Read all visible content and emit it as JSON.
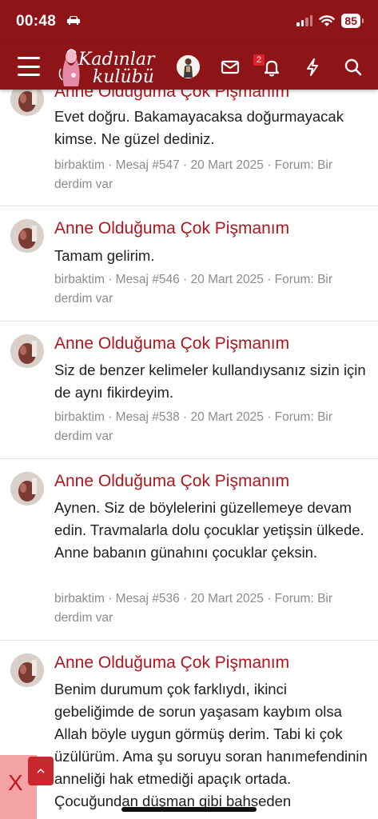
{
  "status_bar": {
    "time": "00:48",
    "battery": "85"
  },
  "header": {
    "logo_line1": "Kadınlar",
    "logo_line2": "kulübü",
    "notification_count": "2"
  },
  "posts": [
    {
      "title": "Anne Olduğuma Çok Pişmanım",
      "body": "Evet doğru. Bakamayacaksa doğurmayacak kimse. Ne güzel dediniz.",
      "meta_line1": "birbaktim · Mesaj #547 · 20 Mart 2025 · Forum: Bir",
      "meta_line2": "derdim var"
    },
    {
      "title": "Anne Olduğuma Çok Pişmanım",
      "body": "Tamam gelirim.",
      "meta_line1": "birbaktim · Mesaj #546 · 20 Mart 2025 · Forum: Bir",
      "meta_line2": "derdim var"
    },
    {
      "title": "Anne Olduğuma Çok Pişmanım",
      "body": "Siz de benzer kelimeler kullandıysanız sizin için de aynı fikirdeyim.",
      "meta_line1": "birbaktim · Mesaj #538 · 20 Mart 2025 · Forum: Bir",
      "meta_line2": "derdim var"
    },
    {
      "title": "Anne Olduğuma Çok Pişmanım",
      "body": "Aynen. Siz de böylelerini güzellemeye devam edin. Travmalarla dolu çocuklar yetişsin ülkede. Anne babanın günahını çocuklar çeksin.",
      "meta_line1": "birbaktim · Mesaj #536 · 20 Mart 2025 · Forum: Bir",
      "meta_line2": "derdim var"
    },
    {
      "title": "Anne Olduğuma Çok Pişmanım",
      "body": "Benim durumum çok farklıydı, ikinci gebeliğimde de sorun yaşasam kaybım olsa Allah böyle uygun görmüş derim. Tabi ki çok üzülürüm. Ama şu soruyu soran hanımefendinin anneliği hak etmediği apaçık ortada. Çocuğundan düşman gibi bahseden",
      "meta_line1": "",
      "meta_line2": ""
    }
  ],
  "ad": {
    "close_label": "X"
  }
}
